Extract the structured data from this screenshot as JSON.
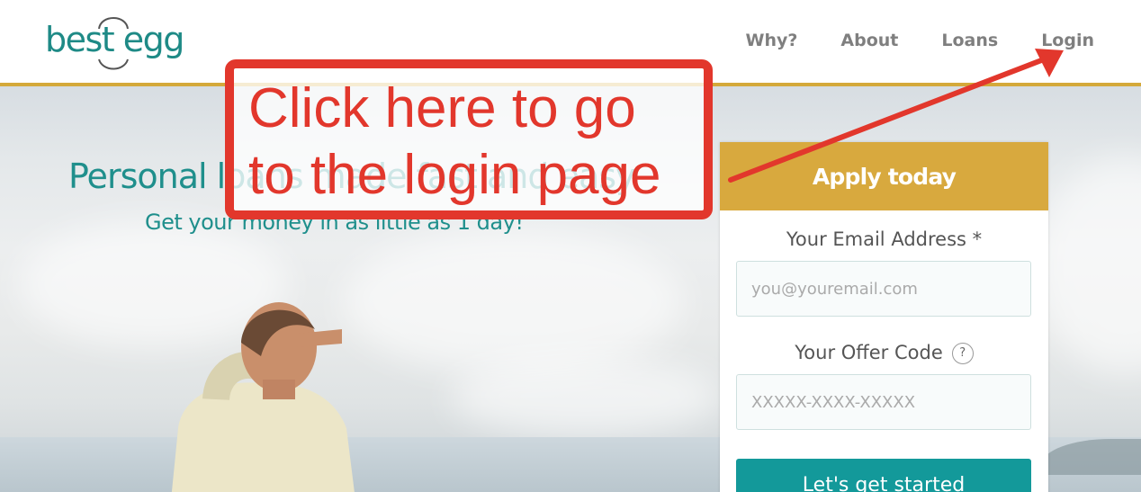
{
  "header": {
    "logo_text": "best egg",
    "nav": [
      {
        "label": "Why?"
      },
      {
        "label": "About"
      },
      {
        "label": "Loans"
      },
      {
        "label": "Login"
      }
    ]
  },
  "hero": {
    "title": "Personal loans made fast and easy",
    "subtitle": "Get your money in as little as 1 day!"
  },
  "form": {
    "heading": "Apply today",
    "email_label": "Your Email Address *",
    "email_placeholder": "you@youremail.com",
    "offer_label": "Your Offer Code",
    "help_icon": "?",
    "offer_placeholder": "XXXXX-XXXX-XXXXX",
    "submit_label": "Let's get started"
  },
  "annotation": {
    "text": "Click here to go\nto the login page"
  },
  "colors": {
    "brand_teal": "#1f8f8c",
    "gold": "#d8a93e",
    "button_teal": "#13999a",
    "annotation_red": "#e2372c"
  }
}
